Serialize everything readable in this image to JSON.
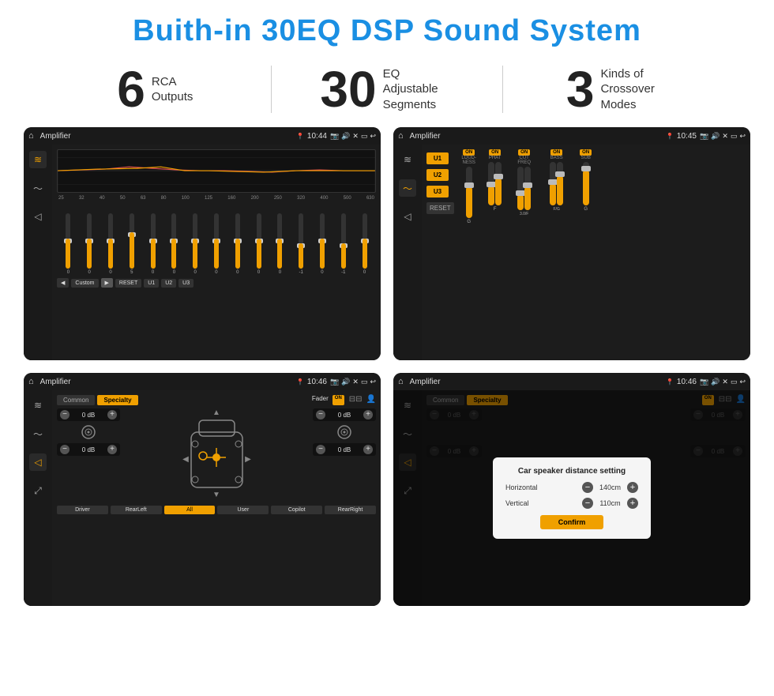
{
  "page": {
    "title": "Buith-in 30EQ DSP Sound System"
  },
  "stats": [
    {
      "number": "6",
      "label": "RCA\nOutputs"
    },
    {
      "number": "30",
      "label": "EQ Adjustable\nSegments"
    },
    {
      "number": "3",
      "label": "Kinds of\nCrossover Modes"
    }
  ],
  "screens": [
    {
      "id": "eq-screen",
      "topbar": {
        "title": "Amplifier",
        "time": "10:44"
      },
      "type": "eq"
    },
    {
      "id": "crossover-screen",
      "topbar": {
        "title": "Amplifier",
        "time": "10:45"
      },
      "type": "crossover"
    },
    {
      "id": "fader-screen",
      "topbar": {
        "title": "Amplifier",
        "time": "10:46"
      },
      "type": "fader"
    },
    {
      "id": "distance-screen",
      "topbar": {
        "title": "Amplifier",
        "time": "10:46"
      },
      "type": "fader-dialog"
    }
  ],
  "eq": {
    "freqs": [
      "25",
      "32",
      "40",
      "50",
      "63",
      "80",
      "100",
      "125",
      "160",
      "200",
      "250",
      "320",
      "400",
      "500",
      "630"
    ],
    "values": [
      "0",
      "0",
      "0",
      "5",
      "0",
      "0",
      "0",
      "0",
      "0",
      "0",
      "0",
      "-1",
      "0",
      "-1",
      "0"
    ],
    "thumbPositions": [
      50,
      50,
      50,
      35,
      50,
      50,
      50,
      50,
      50,
      50,
      50,
      58,
      50,
      58,
      50
    ],
    "buttons": [
      "Custom",
      "RESET",
      "U1",
      "U2",
      "U3"
    ]
  },
  "crossover": {
    "presets": [
      "U1",
      "U2",
      "U3"
    ],
    "sections": [
      {
        "id": "LOUDNESS",
        "on": true
      },
      {
        "id": "PHAT",
        "on": true
      },
      {
        "id": "CUT FREQ",
        "on": true
      },
      {
        "id": "BASS",
        "on": true
      },
      {
        "id": "SUB",
        "on": true
      }
    ]
  },
  "fader": {
    "tabs": [
      "Common",
      "Specialty"
    ],
    "activeTab": "Specialty",
    "controls": [
      {
        "label": "0 dB",
        "side": "left"
      },
      {
        "label": "0 dB",
        "side": "left"
      },
      {
        "label": "0 dB",
        "side": "right"
      },
      {
        "label": "0 dB",
        "side": "right"
      }
    ],
    "bottomBtns": [
      "Driver",
      "RearLeft",
      "All",
      "User",
      "Copilot",
      "RearRight"
    ]
  },
  "dialog": {
    "title": "Car speaker distance setting",
    "fields": [
      {
        "label": "Horizontal",
        "value": "140cm"
      },
      {
        "label": "Vertical",
        "value": "110cm"
      }
    ],
    "confirmLabel": "Confirm"
  }
}
